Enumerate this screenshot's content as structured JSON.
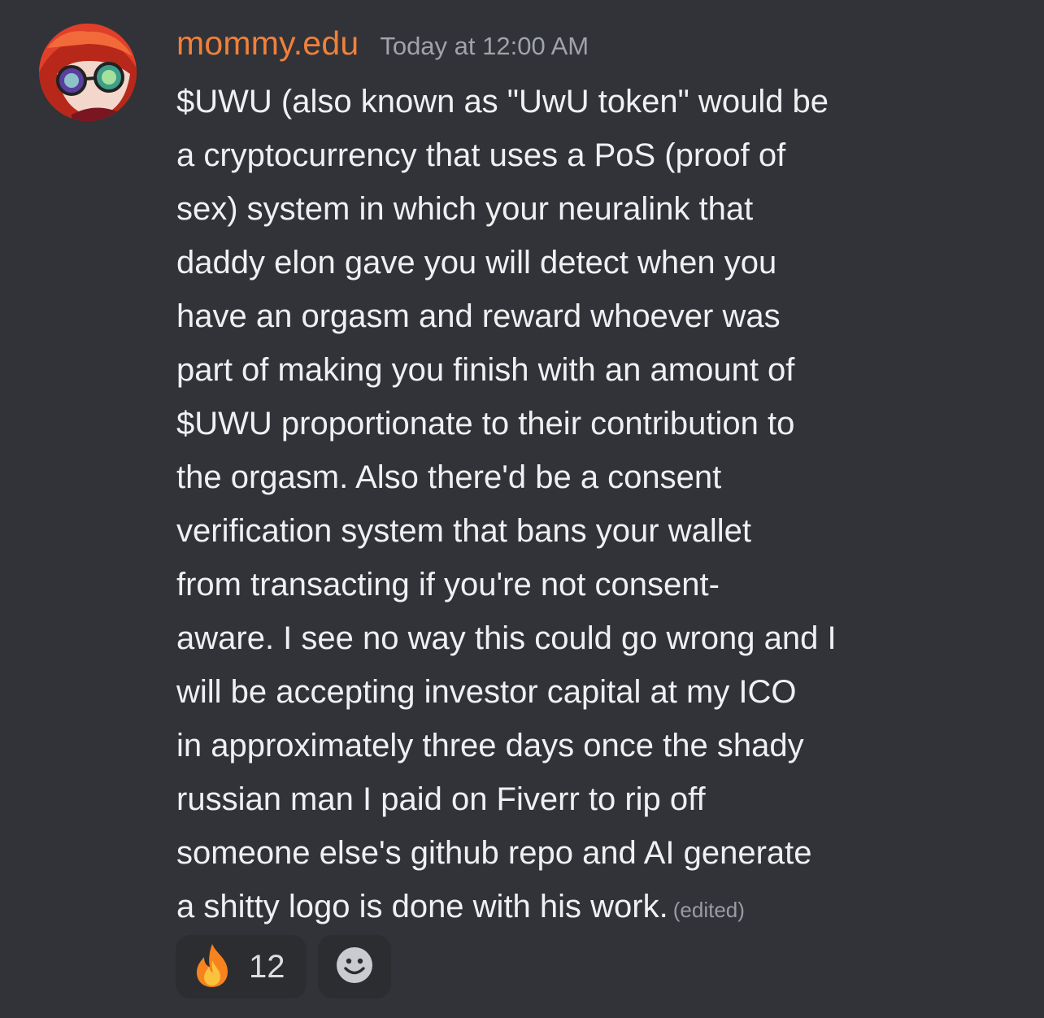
{
  "message": {
    "username": "mommy.edu",
    "timestamp": "Today at 12:00 AM",
    "lines": [
      "$UWU (also known as \"UwU token\" would be",
      "a cryptocurrency that uses a PoS (proof of",
      "sex) system in which your neuralink that",
      "daddy elon gave you will detect when you",
      "have an orgasm and reward whoever was",
      "part of making you finish with an amount of",
      "$UWU proportionate to their contribution to",
      "the orgasm. Also there'd be a consent",
      "verification system that bans your wallet",
      "from transacting if you're not consent-",
      "aware. I see no way this could go wrong and I",
      "will be accepting investor capital at my ICO",
      "in approximately three days once the shady",
      "russian man I paid on Fiverr to rip off",
      "someone else's github repo and AI generate",
      "a shitty logo is done with his work."
    ],
    "edited_label": "(edited)"
  },
  "reactions": [
    {
      "emoji": "fire-icon",
      "count": "12"
    }
  ],
  "add_reaction_icon": "smiley-add-reaction-icon",
  "colors": {
    "background": "#313338",
    "username": "#f0813a",
    "reaction_bg": "#2b2d31"
  }
}
